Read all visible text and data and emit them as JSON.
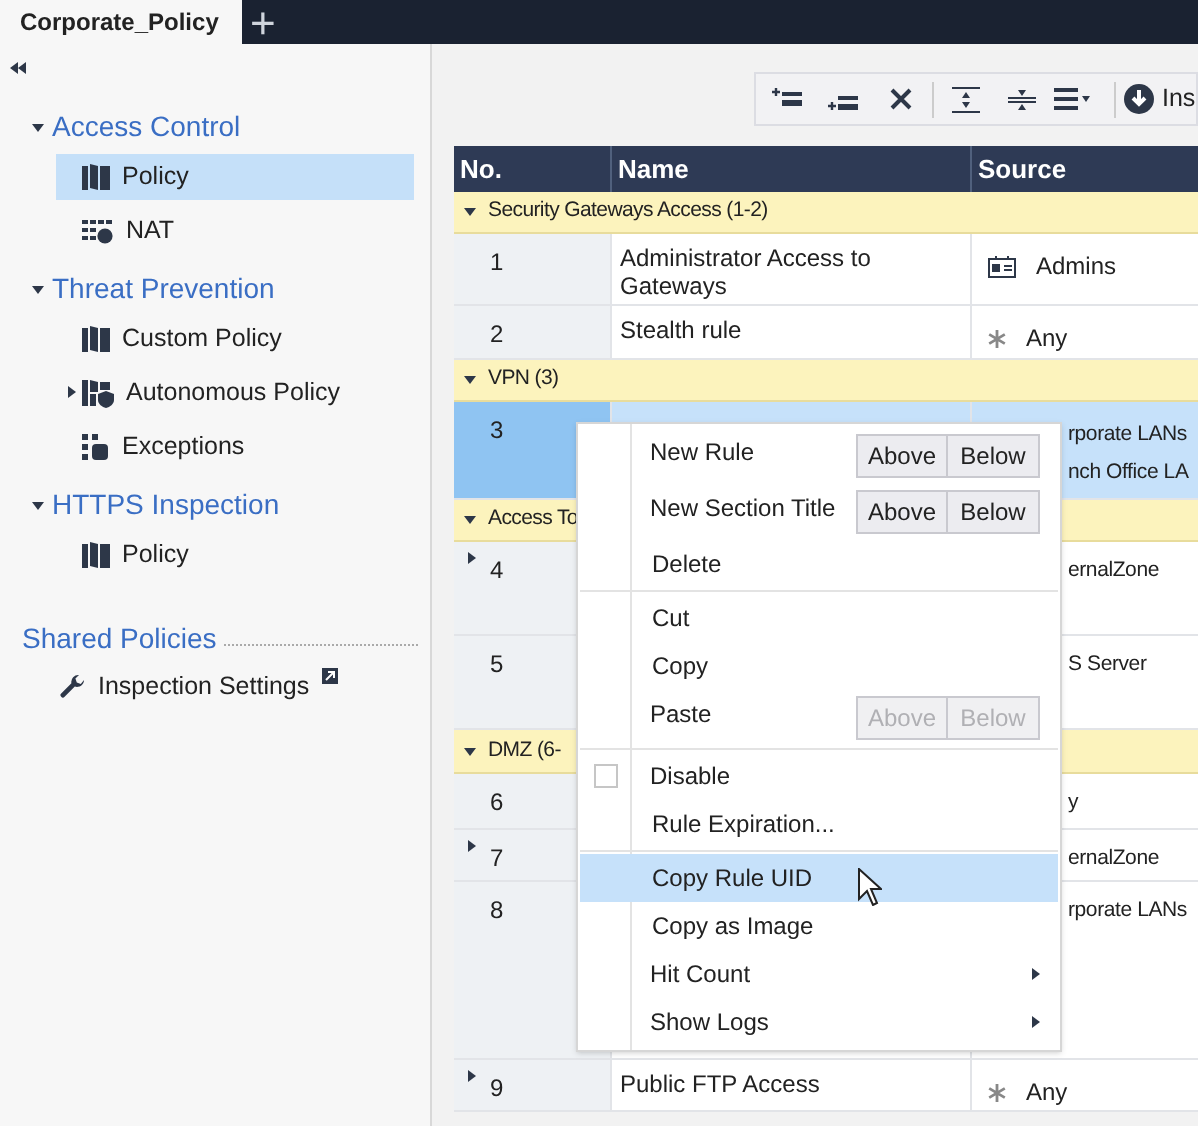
{
  "tabs": [
    {
      "label": "Corporate_Policy",
      "selected": true
    },
    {
      "label": "+",
      "selected": false
    }
  ],
  "sidebar": {
    "sections": [
      {
        "title": "Access Control",
        "expanded": true,
        "children": [
          {
            "label": "Policy",
            "selected": true
          },
          {
            "label": "NAT",
            "selected": false
          }
        ]
      },
      {
        "title": "Threat Prevention",
        "expanded": true,
        "children": [
          {
            "label": "Custom Policy",
            "selected": false
          },
          {
            "label": "Autonomous Policy",
            "selected": false,
            "expanded": false
          },
          {
            "label": "Exceptions",
            "selected": false
          }
        ]
      },
      {
        "title": "HTTPS Inspection",
        "expanded": true,
        "children": [
          {
            "label": "Policy",
            "selected": false
          }
        ]
      }
    ],
    "shared": {
      "title": "Shared Policies",
      "items": [
        {
          "label": "Inspection Settings"
        }
      ]
    }
  },
  "toolbar": {
    "insert_label": "Ins"
  },
  "table": {
    "columns": [
      "No.",
      "Name",
      "Source"
    ],
    "rows": [
      {
        "kind": "section",
        "label": "Security Gateways Access (1-2)",
        "expanded": true
      },
      {
        "kind": "rule",
        "no": "1",
        "name": "Administrator Access to Gateways",
        "source": "Admins",
        "selected": false
      },
      {
        "kind": "rule",
        "no": "2",
        "name": "Stealth rule",
        "source": "Any",
        "selected": false
      },
      {
        "kind": "section",
        "label": "VPN (3)",
        "expanded": true
      },
      {
        "kind": "rule",
        "no": "3",
        "source_lines": [
          "rporate LANs",
          "nch Office LA"
        ],
        "selected": true
      },
      {
        "kind": "section",
        "label": "Access To",
        "expanded": true
      },
      {
        "kind": "rule",
        "no": "4",
        "source": "ernalZone",
        "expanded": false,
        "selected": false
      },
      {
        "kind": "rule",
        "no": "5",
        "source": "S Server",
        "selected": false
      },
      {
        "kind": "section",
        "label": "DMZ (6-",
        "expanded": true
      },
      {
        "kind": "rule",
        "no": "6",
        "source": "y",
        "selected": false
      },
      {
        "kind": "rule",
        "no": "7",
        "source": "ernalZone",
        "expanded": false,
        "selected": false
      },
      {
        "kind": "rule",
        "no": "8",
        "source": "rporate LANs",
        "selected": false
      },
      {
        "kind": "rule",
        "no": "9",
        "name": "Public FTP Access",
        "source": "Any",
        "expanded": false,
        "selected": false
      }
    ]
  },
  "context_menu": {
    "items": [
      {
        "kind": "split",
        "label": "New Rule",
        "buttons": [
          {
            "label": "Above",
            "disabled": false
          },
          {
            "label": "Below",
            "disabled": false
          }
        ]
      },
      {
        "kind": "split",
        "label": "New Section Title",
        "buttons": [
          {
            "label": "Above",
            "disabled": false
          },
          {
            "label": "Below",
            "disabled": false
          }
        ]
      },
      {
        "kind": "plain",
        "label": "Delete",
        "selected": false
      },
      {
        "kind": "separator"
      },
      {
        "kind": "plain",
        "label": "Cut",
        "selected": false
      },
      {
        "kind": "plain",
        "label": "Copy",
        "selected": false
      },
      {
        "kind": "split",
        "label": "Paste",
        "buttons": [
          {
            "label": "Above",
            "disabled": true
          },
          {
            "label": "Below",
            "disabled": true
          }
        ]
      },
      {
        "kind": "separator"
      },
      {
        "kind": "check",
        "label": "Disable",
        "checked": false
      },
      {
        "kind": "plain",
        "label": "Rule Expiration...",
        "selected": false
      },
      {
        "kind": "separator"
      },
      {
        "kind": "plain",
        "label": "Copy Rule UID",
        "selected": true
      },
      {
        "kind": "plain",
        "label": "Copy as Image",
        "selected": false
      },
      {
        "kind": "submenu",
        "label": "Hit Count"
      },
      {
        "kind": "submenu",
        "label": "Show Logs"
      }
    ]
  }
}
